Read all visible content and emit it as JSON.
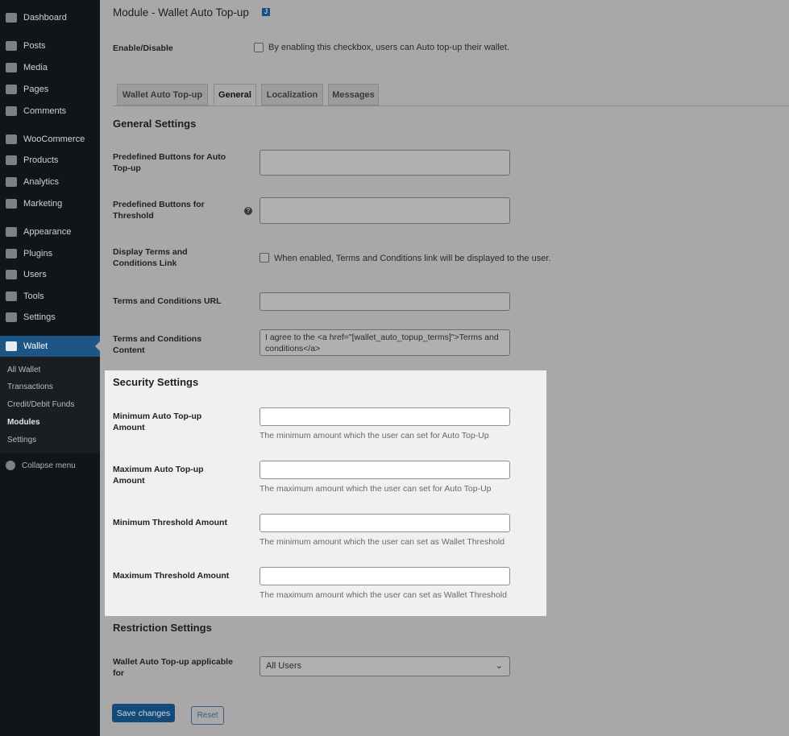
{
  "sidebar": {
    "items": [
      "Dashboard",
      "Posts",
      "Media",
      "Pages",
      "Comments",
      "WooCommerce",
      "Products",
      "Analytics",
      "Marketing",
      "Appearance",
      "Plugins",
      "Users",
      "Tools",
      "Settings"
    ],
    "active": "Wallet",
    "submenu": [
      "All Wallet",
      "Transactions",
      "Credit/Debit Funds",
      "Modules",
      "Settings"
    ],
    "collapse": "Collapse menu"
  },
  "page": {
    "title": "Module - Wallet Auto Top-up",
    "enable_label": "Enable/Disable",
    "enable_text": "By enabling this checkbox, users can Auto top-up their wallet.",
    "tabs": [
      "Wallet Auto Top-up",
      "General",
      "Localization",
      "Messages"
    ],
    "general": {
      "heading": "General Settings",
      "predef_auto": "Predefined Buttons for Auto Top-up",
      "predef_threshold": "Predefined Buttons for Threshold",
      "display_terms": "Display Terms and Conditions Link",
      "display_terms_text": "When enabled, Terms and Conditions link will be displayed to the user.",
      "terms_url": "Terms and Conditions URL",
      "terms_content": "Terms and Conditions Content",
      "terms_content_value": "I agree to the <a href=\"[wallet_auto_topup_terms]\">Terms and conditions</a>"
    },
    "security": {
      "heading": "Security Settings",
      "rows": [
        {
          "label": "Minimum Auto Top-up Amount",
          "desc": "The minimum amount which the user can set for Auto Top-Up"
        },
        {
          "label": "Maximum Auto Top-up Amount",
          "desc": "The maximum amount which the user can set for Auto Top-Up"
        },
        {
          "label": "Minimum Threshold Amount",
          "desc": "The minimum amount which the user can set as Wallet Threshold"
        },
        {
          "label": "Maximum Threshold Amount",
          "desc": "The maximum amount which the user can set as Wallet Threshold"
        }
      ]
    },
    "restriction": {
      "heading": "Restriction Settings",
      "label": "Wallet Auto Top-up applicable for",
      "value": "All Users"
    },
    "save": "Save changes",
    "reset": "Reset"
  }
}
